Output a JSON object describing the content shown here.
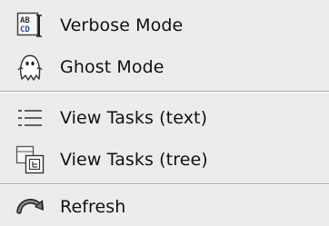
{
  "menu": {
    "items": [
      {
        "label": "Verbose Mode",
        "icon": "verbose-abc-icon"
      },
      {
        "label": "Ghost Mode",
        "icon": "ghost-icon"
      },
      {
        "label": "View Tasks (text)",
        "icon": "list-view-icon"
      },
      {
        "label": "View Tasks (tree)",
        "icon": "tree-view-icon"
      },
      {
        "label": "Refresh",
        "icon": "refresh-arrow-icon"
      }
    ],
    "verbose_icon_text": "ABC",
    "tree_icon_text": "[]"
  },
  "colors": {
    "background": "#ececec",
    "text": "#111111",
    "separator_dark": "#a8a8a8",
    "separator_light": "#ffffff",
    "icon_blue": "#2b4f9e"
  }
}
